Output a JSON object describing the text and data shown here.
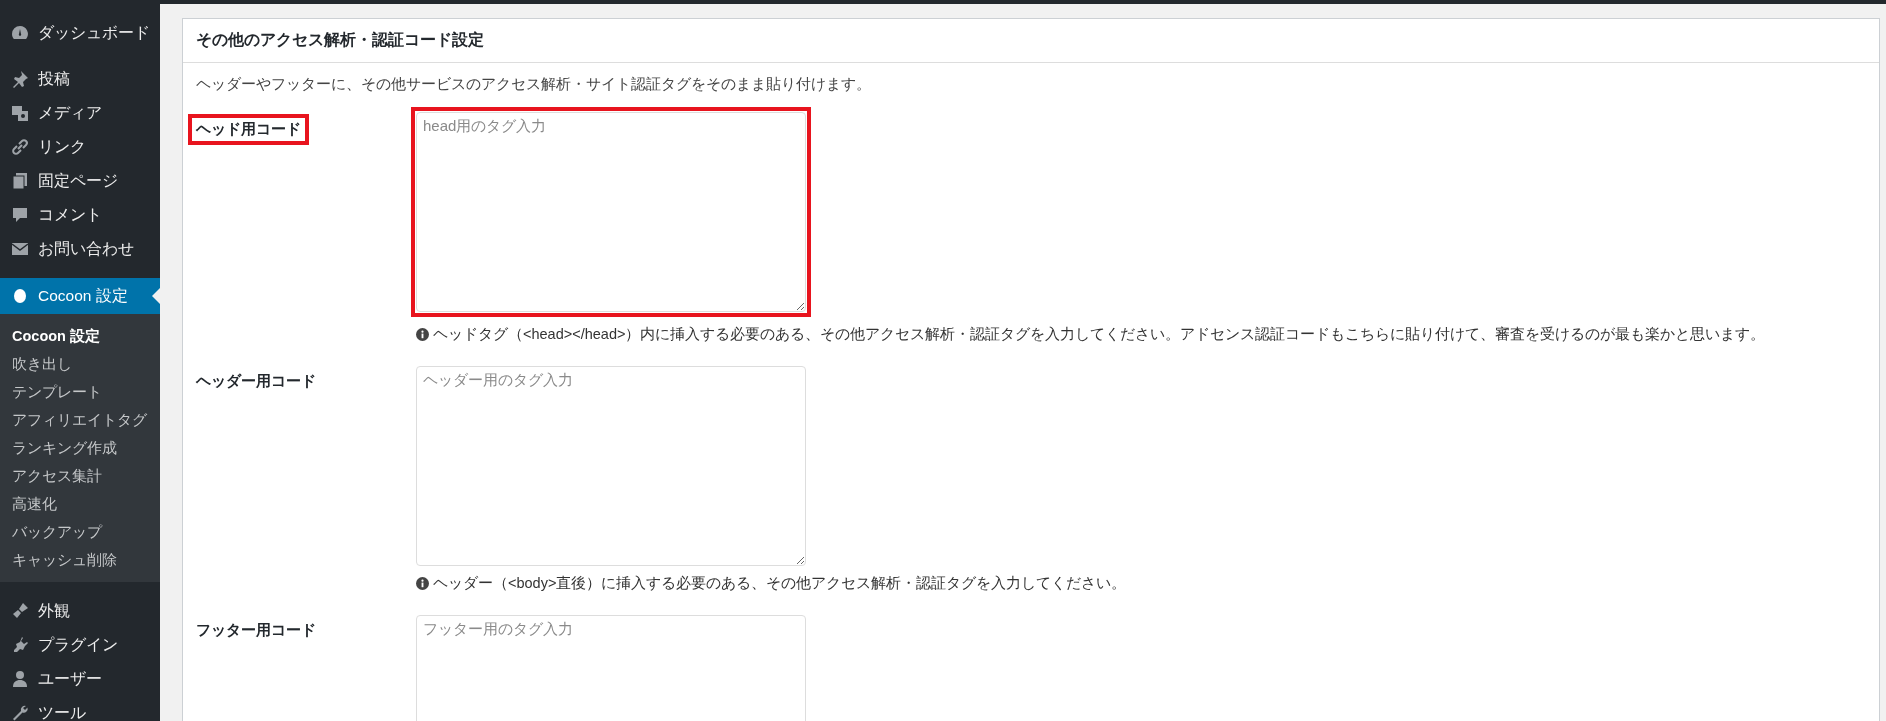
{
  "sidebar": {
    "items": [
      {
        "label": "ダッシュボード",
        "kind": "dashboard",
        "selected": false
      },
      {
        "label": "投稿",
        "kind": "pin",
        "selected": false
      },
      {
        "label": "メディア",
        "kind": "media",
        "selected": false
      },
      {
        "label": "リンク",
        "kind": "link",
        "selected": false
      },
      {
        "label": "固定ページ",
        "kind": "pages",
        "selected": false
      },
      {
        "label": "コメント",
        "kind": "comment",
        "selected": false
      },
      {
        "label": "お問い合わせ",
        "kind": "mail",
        "selected": false
      },
      {
        "label": "Cocoon 設定",
        "kind": "circle",
        "selected": true,
        "children": [
          {
            "label": "Cocoon 設定",
            "selected": true
          },
          {
            "label": "吹き出し",
            "selected": false
          },
          {
            "label": "テンプレート",
            "selected": false
          },
          {
            "label": "アフィリエイトタグ",
            "selected": false
          },
          {
            "label": "ランキング作成",
            "selected": false
          },
          {
            "label": "アクセス集計",
            "selected": false
          },
          {
            "label": "高速化",
            "selected": false
          },
          {
            "label": "バックアップ",
            "selected": false
          },
          {
            "label": "キャッシュ削除",
            "selected": false
          }
        ]
      },
      {
        "label": "外観",
        "kind": "brush",
        "selected": false
      },
      {
        "label": "プラグイン",
        "kind": "plug",
        "selected": false
      },
      {
        "label": "ユーザー",
        "kind": "user",
        "selected": false
      },
      {
        "label": "ツール",
        "kind": "wrench",
        "selected": false
      }
    ]
  },
  "panel": {
    "title": "その他のアクセス解析・認証コード設定",
    "description": "ヘッダーやフッターに、その他サービスのアクセス解析・サイト認証タグをそのまま貼り付けます。",
    "fields": [
      {
        "label": "ヘッド用コード",
        "placeholder": "head用のタグ入力",
        "highlighted": true,
        "help": "ヘッドタグ（<head></head>）内に挿入する必要のある、その他アクセス解析・認証タグを入力してください。アドセンス認証コードもこちらに貼り付けて、審査を受けるのが最も楽かと思います。"
      },
      {
        "label": "ヘッダー用コード",
        "placeholder": "ヘッダー用のタグ入力",
        "highlighted": false,
        "help": "ヘッダー（<body>直後）に挿入する必要のある、その他アクセス解析・認証タグを入力してください。"
      },
      {
        "label": "フッター用コード",
        "placeholder": "フッター用のタグ入力",
        "highlighted": false
      }
    ]
  }
}
